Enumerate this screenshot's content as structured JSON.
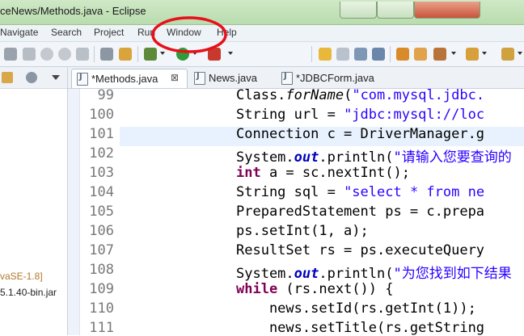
{
  "window": {
    "title": "ceNews/Methods.java - Eclipse"
  },
  "menu": [
    "Navigate",
    "Search",
    "Project",
    "Run",
    "Window",
    "Help"
  ],
  "tabs": [
    {
      "label": "*Methods.java",
      "close": "⊠"
    },
    {
      "label": "News.java"
    },
    {
      "label": "*JDBCForm.java"
    }
  ],
  "left_panel": {
    "lines": [
      "vaSE-1.8]",
      "5.1.40-bin.jar"
    ]
  },
  "editor": {
    "line_numbers": [
      "99",
      "100",
      "101",
      "102",
      "103",
      "104",
      "105",
      "106",
      "107",
      "108",
      "109",
      "110",
      "111"
    ],
    "lines": [
      [
        "Class.",
        "forName",
        "(",
        "\"com.mysql.jdbc."
      ],
      [
        "String url = ",
        "\"jdbc:mysql://loc"
      ],
      [
        "Connection c = DriverManager.g"
      ],
      [
        "System.",
        "out",
        ".println(",
        "\"请输入您要查询的"
      ],
      [
        "int",
        " a = sc.nextInt();"
      ],
      [
        "String sql = ",
        "\"select * from ne"
      ],
      [
        "PreparedStatement ps = c.prepa"
      ],
      [
        "ps.setInt(1, a);"
      ],
      [
        "ResultSet rs = ps.executeQuery"
      ],
      [
        "System.",
        "out",
        ".println(",
        "\"为您找到如下结果"
      ],
      [
        "while",
        " (rs.next()) {"
      ],
      [
        "    news.setId(rs.getInt(1));"
      ],
      [
        "    news.setTitle(rs.getString"
      ]
    ]
  },
  "colors": {
    "annotation": "#e8101a",
    "keyword": "#7f0055",
    "string": "#2a00ff",
    "current_line": "#e8f2fe"
  }
}
